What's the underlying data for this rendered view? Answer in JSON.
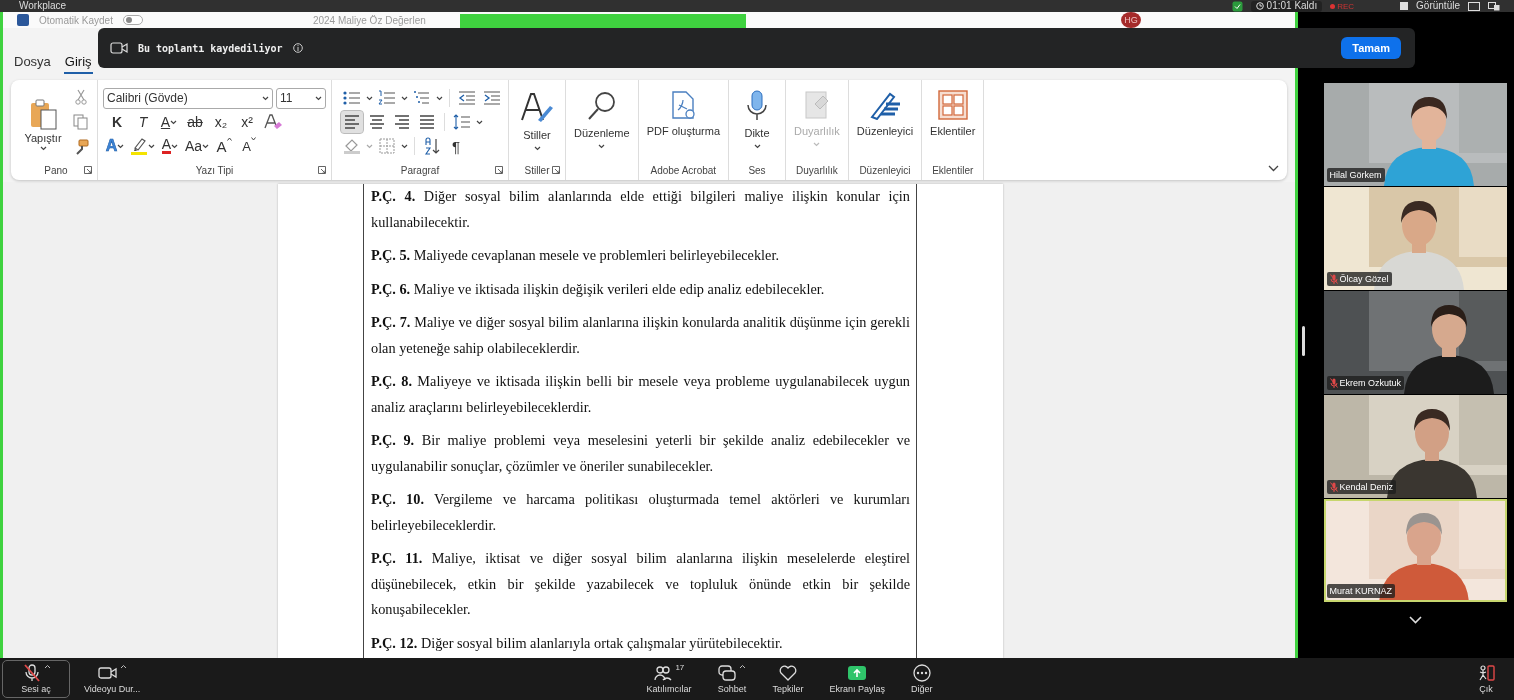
{
  "zoom_top_bar": {
    "title": "Workplace",
    "timer": "01:01 Kaldı",
    "recording": "REC",
    "view": "Görüntüle"
  },
  "word": {
    "title_bar": {
      "autosave": "Otomatik Kaydet",
      "autosave_on": false,
      "document": "2024 Maliye Öz Değerlen",
      "avatar": "HG"
    },
    "tabs": [
      {
        "label": "Dosya",
        "selected": false
      },
      {
        "label": "Giriş",
        "selected": true
      }
    ],
    "ribbon": {
      "clipboard": {
        "name": "Pano",
        "paste": "Yapıştır",
        "launcher": true
      },
      "font": {
        "name": "Yazı Tipi",
        "launcher": true,
        "font_name": "Calibri (Gövde)",
        "font_size": "11",
        "row_1": [
          {
            "kind": "bold",
            "label": "K",
            "menu": false
          },
          {
            "kind": "italic",
            "label": "T",
            "menu": false
          },
          {
            "kind": "underline",
            "label": "A",
            "menu": true
          },
          {
            "kind": "strike",
            "label": "ab",
            "menu": false
          },
          {
            "kind": "sub",
            "label": "x₂",
            "menu": false
          },
          {
            "kind": "sup",
            "label": "x²",
            "menu": false
          },
          {
            "kind": "clear",
            "menu": false
          }
        ],
        "row_2": [
          {
            "kind": "effects",
            "label": "A",
            "menu": true
          },
          {
            "kind": "highlight",
            "menu": true
          },
          {
            "kind": "color",
            "label": "A",
            "menu": true
          },
          {
            "kind": "case",
            "label": "Aa",
            "menu": true
          },
          {
            "kind": "grow",
            "label": "A",
            "menu": false
          },
          {
            "kind": "shrink",
            "label": "A",
            "menu": false
          }
        ]
      },
      "paragraph": {
        "name": "Paragraf",
        "launcher": true,
        "alignment": [
          {
            "kind": "left",
            "selected": true
          },
          {
            "kind": "center",
            "selected": false
          },
          {
            "kind": "right",
            "selected": false
          },
          {
            "kind": "justify",
            "selected": false
          }
        ],
        "pilcrow": "¶"
      },
      "groups": [
        {
          "kind": "styles",
          "button": "Stiller",
          "menu": true,
          "disabled": false,
          "name": "Stiller",
          "launcher": true
        },
        {
          "kind": "editing",
          "button": "Düzenleme",
          "menu": true,
          "disabled": false,
          "launcher": false
        },
        {
          "kind": "pdf",
          "button": "PDF oluşturma",
          "menu": false,
          "disabled": false,
          "name": "Adobe Acrobat",
          "launcher": false
        },
        {
          "kind": "dictate",
          "button": "Dikte",
          "menu": true,
          "disabled": false,
          "name": "Ses",
          "launcher": false
        },
        {
          "kind": "sensitivity",
          "button": "Duyarlılık",
          "menu": true,
          "disabled": true,
          "name": "Duyarlılık",
          "launcher": false
        },
        {
          "kind": "editor",
          "button": "Düzenleyici",
          "menu": false,
          "disabled": false,
          "name": "Düzenleyici",
          "launcher": false
        },
        {
          "kind": "addins",
          "button": "Eklentiler",
          "menu": false,
          "disabled": false,
          "name": "Eklentiler",
          "launcher": false
        }
      ]
    },
    "document": {
      "paragraphs": [
        "**P.Ç. 4.** Diğer sosyal bilim alanlarında elde ettiği bilgileri maliye ilişkin konular için kullanabilecektir.",
        "**P.Ç. 5.** Maliyede cevaplanan mesele ve problemleri belirleyebilecekler.",
        "**P.Ç. 6.** Maliye ve iktisada ilişkin değişik verileri elde edip analiz edebilecekler.",
        "**P.Ç. 7.** Maliye ve diğer sosyal bilim alanlarına ilişkin konularda analitik düşünme için gerekli olan yeteneğe sahip olabileceklerdir.",
        "**P.Ç. 8.** Maliyeye ve iktisada ilişkin belli bir mesele veya probleme uygulanabilecek uygun analiz araçlarını belirleyebileceklerdir.",
        "**P.Ç. 9.** Bir maliye problemi veya meselesini yeterli bir şekilde analiz edebilecekler ve uygulanabilir sonuçlar, çözümler ve öneriler sunabilecekler.",
        "**P.Ç. 10.** Vergileme ve harcama politikası oluşturmada temel aktörleri ve kurumları belirleyebileceklerdir.",
        "**P.Ç. 11.** Maliye, iktisat ve diğer sosyal bilim alanlarına ilişkin meselelerde eleştirel düşünebilecek, etkin bir şekilde yazabilecek ve topluluk önünde etkin bir şekilde konuşabilecekler.",
        "**P.Ç. 12.** Diğer sosyal bilim alanlarıyla ortak çalışmalar yürütebilecektir."
      ]
    }
  },
  "recording_banner": {
    "message": "Bu toplantı kaydediliyor",
    "button": "Tamam"
  },
  "participants": [
    {
      "name": "Hilal Görkem",
      "muted": false,
      "active_speaker": false,
      "kind": "picture"
    },
    {
      "name": "Ölcay Gözel",
      "muted": true,
      "active_speaker": false,
      "kind": "picture"
    },
    {
      "name": "Ekrem Ozkutuk",
      "muted": true,
      "active_speaker": false,
      "kind": "picture"
    },
    {
      "name": "Kendal Deniz",
      "muted": true,
      "active_speaker": false,
      "kind": "picture"
    },
    {
      "name": "Murat KURNAZ",
      "muted": false,
      "active_speaker": true,
      "kind": "picture"
    }
  ],
  "toolbar": {
    "audio_muted": true,
    "participant_count": "17",
    "buttons": [
      {
        "kind": "mic",
        "label": "Sesi aç",
        "menu": true
      },
      {
        "kind": "video",
        "label": "Videoyu Dur...",
        "menu": true
      },
      {
        "kind": "participants",
        "label": "Katılımcılar",
        "menu": false
      },
      {
        "kind": "chat",
        "label": "Sohbet",
        "menu": true
      },
      {
        "kind": "reactions",
        "label": "Tepkiler",
        "menu": false
      },
      {
        "kind": "share",
        "label": "Ekranı Paylaş",
        "menu": false
      },
      {
        "kind": "more",
        "label": "Diğer",
        "menu": false
      },
      {
        "kind": "leave",
        "label": "Çık",
        "menu": false
      }
    ]
  }
}
